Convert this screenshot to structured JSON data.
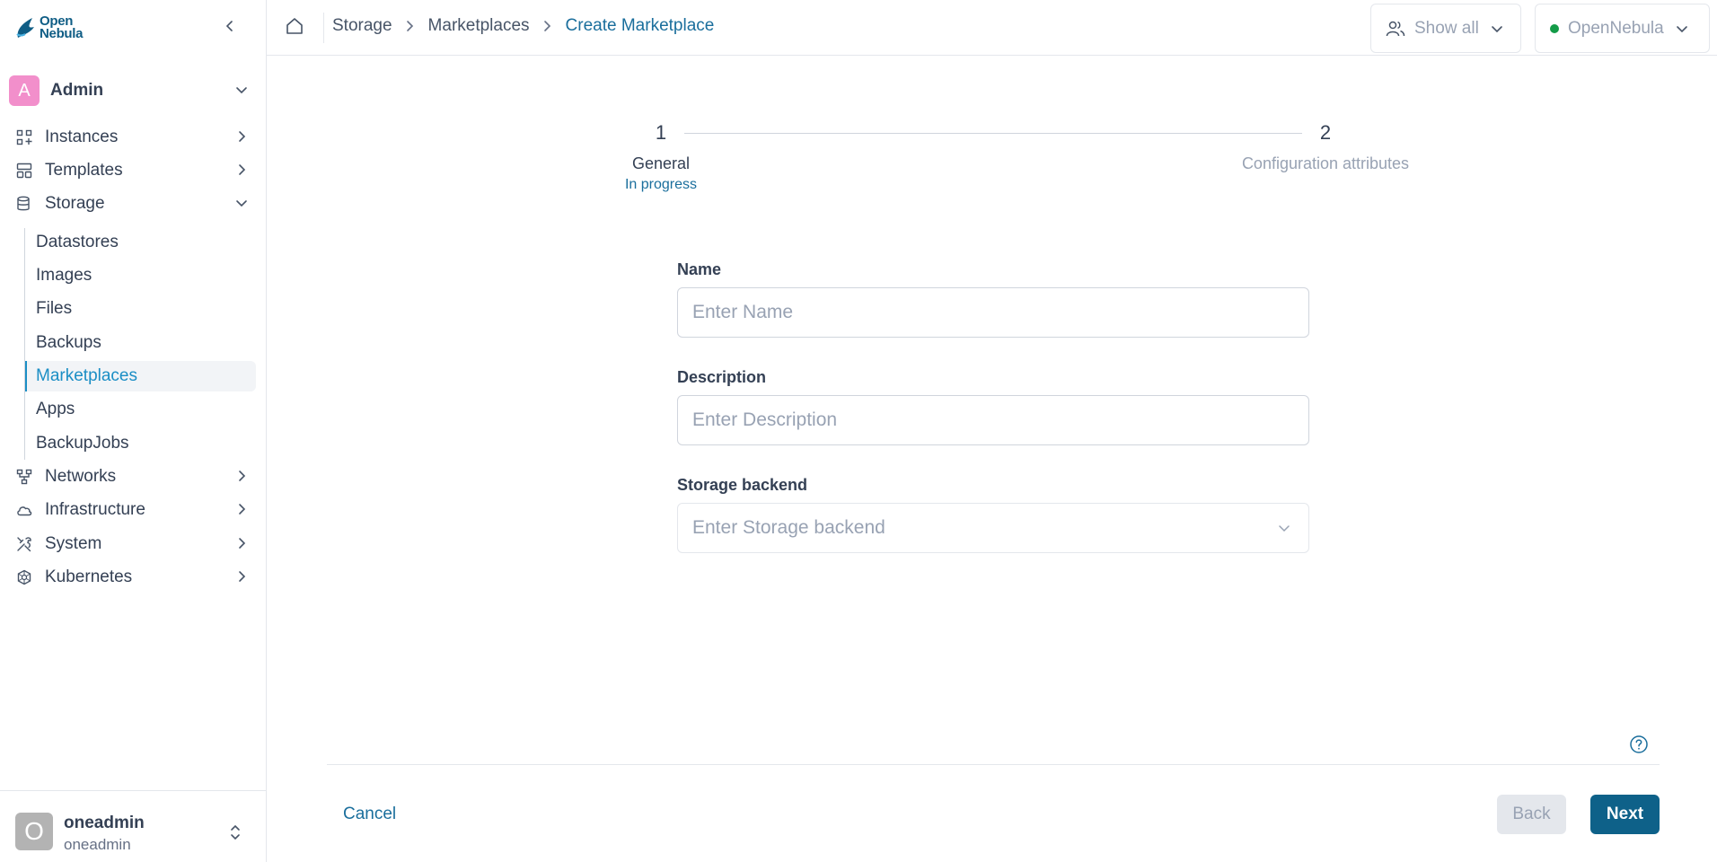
{
  "brand": {
    "line1": "Open",
    "line2": "Nebula"
  },
  "sidebar": {
    "group": {
      "initial": "A",
      "label": "Admin"
    },
    "items": [
      {
        "label": "Instances",
        "icon": "grid-icon"
      },
      {
        "label": "Templates",
        "icon": "layout-icon"
      },
      {
        "label": "Storage",
        "icon": "database-icon"
      },
      {
        "label": "Networks",
        "icon": "network-icon"
      },
      {
        "label": "Infrastructure",
        "icon": "cloud-icon"
      },
      {
        "label": "System",
        "icon": "tools-icon"
      },
      {
        "label": "Kubernetes",
        "icon": "kubernetes-icon"
      }
    ],
    "storage_sub": [
      "Datastores",
      "Images",
      "Files",
      "Backups",
      "Marketplaces",
      "Apps",
      "BackupJobs"
    ],
    "active_sub": "Marketplaces"
  },
  "user": {
    "initial": "O",
    "name": "oneadmin",
    "group": "oneadmin"
  },
  "breadcrumb": {
    "items": [
      "Storage",
      "Marketplaces"
    ],
    "current": "Create Marketplace"
  },
  "header": {
    "filter_label": "Show all",
    "zone_label": "OpenNebula",
    "zone_status_color": "#139b48"
  },
  "stepper": {
    "steps": [
      {
        "number": "1",
        "title": "General",
        "status": "In progress"
      },
      {
        "number": "2",
        "title": "Configuration attributes"
      }
    ]
  },
  "form": {
    "name": {
      "label": "Name",
      "placeholder": "Enter Name"
    },
    "description": {
      "label": "Description",
      "placeholder": "Enter Description"
    },
    "storage_backend": {
      "label": "Storage backend",
      "placeholder": "Enter Storage backend"
    }
  },
  "footer": {
    "cancel": "Cancel",
    "back": "Back",
    "next": "Next"
  },
  "colors": {
    "accent": "#1a6e9c",
    "primary_button": "#0e6189",
    "active_nav": "#1b8ec5",
    "avatar_admin": "#f28fcb"
  }
}
